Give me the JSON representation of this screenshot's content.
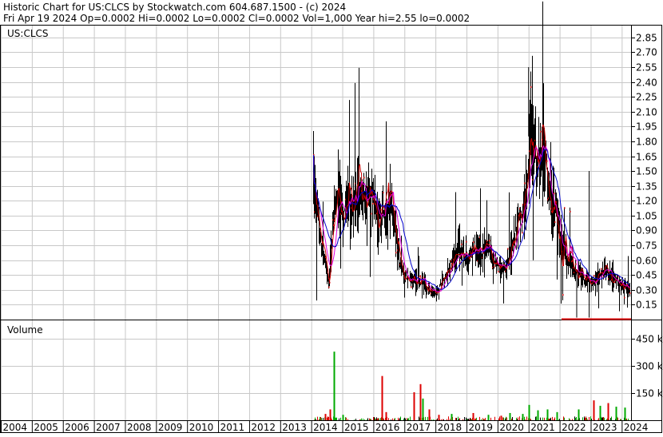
{
  "header": {
    "line1": "Historic Chart for US:CLCS by Stockwatch.com 604.687.1500 - (c) 2024",
    "line2": "Fri Apr 19 2024   Op=0.0002  Hi=0.0002  Lo=0.0002  Cl=0.0002  Vol=1,000   Year hi=2.55  lo=0.0002"
  },
  "symbol_label": "US:CLCS",
  "volume_label": "Volume",
  "colors": {
    "candle": "#000000",
    "ma_short": "#cc0000",
    "ma_mid": "#dd00dd",
    "ma_long": "#0000cc",
    "vol_up": "#00aa00",
    "vol_down": "#dd0000",
    "vol_flat": "#000000",
    "grid": "#c8c8c8"
  },
  "chart_data": [
    {
      "type": "candlestick",
      "title": "US:CLCS",
      "y_ticks": [
        "2.85",
        "2.70",
        "2.55",
        "2.40",
        "2.25",
        "2.10",
        "1.95",
        "1.80",
        "1.65",
        "1.50",
        "1.35",
        "1.20",
        "1.05",
        "0.90",
        "0.75",
        "0.60",
        "0.45",
        "0.30",
        "0.15"
      ],
      "ylim": [
        0,
        2.97
      ],
      "xlim": [
        2004.0,
        2024.3
      ],
      "x_ticks": [
        "2004",
        "2005",
        "2006",
        "2007",
        "2008",
        "2009",
        "2010",
        "2011",
        "2012",
        "2013",
        "2014",
        "2015",
        "2016",
        "2017",
        "2018",
        "2019",
        "2020",
        "2021",
        "2022",
        "2023",
        "2024"
      ],
      "price_path": [
        [
          2014.05,
          1.6
        ],
        [
          2014.15,
          1.25
        ],
        [
          2014.3,
          0.75
        ],
        [
          2014.45,
          0.55
        ],
        [
          2014.55,
          0.35
        ],
        [
          2014.7,
          0.95
        ],
        [
          2014.85,
          1.35
        ],
        [
          2015.0,
          1.05
        ],
        [
          2015.15,
          1.2
        ],
        [
          2015.35,
          1.15
        ],
        [
          2015.55,
          1.3
        ],
        [
          2015.75,
          1.2
        ],
        [
          2015.95,
          1.25
        ],
        [
          2016.1,
          1.0
        ],
        [
          2016.3,
          1.05
        ],
        [
          2016.5,
          1.2
        ],
        [
          2016.7,
          0.9
        ],
        [
          2016.85,
          0.55
        ],
        [
          2017.0,
          0.45
        ],
        [
          2017.2,
          0.4
        ],
        [
          2017.4,
          0.38
        ],
        [
          2017.6,
          0.36
        ],
        [
          2017.8,
          0.3
        ],
        [
          2018.0,
          0.25
        ],
        [
          2018.15,
          0.35
        ],
        [
          2018.35,
          0.45
        ],
        [
          2018.55,
          0.65
        ],
        [
          2018.75,
          0.75
        ],
        [
          2019.0,
          0.6
        ],
        [
          2019.25,
          0.7
        ],
        [
          2019.45,
          0.65
        ],
        [
          2019.65,
          0.72
        ],
        [
          2019.85,
          0.6
        ],
        [
          2020.05,
          0.55
        ],
        [
          2020.25,
          0.5
        ],
        [
          2020.45,
          0.75
        ],
        [
          2020.65,
          1.0
        ],
        [
          2020.85,
          1.1
        ],
        [
          2021.0,
          1.6
        ],
        [
          2021.1,
          2.05
        ],
        [
          2021.25,
          1.55
        ],
        [
          2021.45,
          1.8
        ],
        [
          2021.65,
          1.4
        ],
        [
          2021.85,
          1.1
        ],
        [
          2022.05,
          0.75
        ],
        [
          2022.3,
          0.55
        ],
        [
          2022.55,
          0.48
        ],
        [
          2022.8,
          0.4
        ],
        [
          2023.05,
          0.38
        ],
        [
          2023.3,
          0.45
        ],
        [
          2023.55,
          0.48
        ],
        [
          2023.8,
          0.4
        ],
        [
          2024.05,
          0.35
        ],
        [
          2024.25,
          0.33
        ]
      ],
      "moving_averages": [
        "ma_short",
        "ma_mid",
        "ma_long"
      ]
    },
    {
      "type": "bar",
      "title": "Volume",
      "y_ticks": [
        "450 k",
        "300 k",
        "150 k"
      ],
      "ylim": [
        0,
        540
      ],
      "spikes_k": [
        [
          2014.72,
          380,
          "up"
        ],
        [
          2014.6,
          60,
          "down"
        ],
        [
          2014.45,
          35,
          "down"
        ],
        [
          2015.0,
          30,
          "up"
        ],
        [
          2016.28,
          245,
          "down"
        ],
        [
          2016.4,
          45,
          "down"
        ],
        [
          2017.3,
          155,
          "down"
        ],
        [
          2017.5,
          200,
          "down"
        ],
        [
          2017.58,
          120,
          "up"
        ],
        [
          2017.8,
          60,
          "down"
        ],
        [
          2018.1,
          30,
          "down"
        ],
        [
          2018.5,
          35,
          "up"
        ],
        [
          2019.2,
          40,
          "down"
        ],
        [
          2019.7,
          30,
          "up"
        ],
        [
          2020.1,
          25,
          "down"
        ],
        [
          2020.4,
          40,
          "up"
        ],
        [
          2020.8,
          35,
          "up"
        ],
        [
          2021.0,
          85,
          "up"
        ],
        [
          2021.3,
          55,
          "up"
        ],
        [
          2021.6,
          60,
          "up"
        ],
        [
          2021.9,
          45,
          "up"
        ],
        [
          2022.6,
          60,
          "up"
        ],
        [
          2023.1,
          110,
          "down"
        ],
        [
          2023.3,
          80,
          "up"
        ],
        [
          2023.55,
          95,
          "down"
        ],
        [
          2023.8,
          75,
          "up"
        ],
        [
          2024.1,
          70,
          "up"
        ]
      ]
    }
  ]
}
